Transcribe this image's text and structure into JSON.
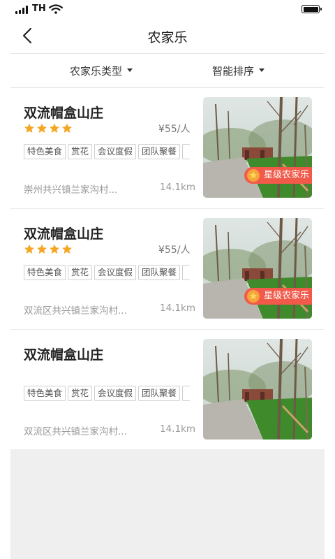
{
  "status": {
    "carrier": "TH"
  },
  "header": {
    "title": "农家乐"
  },
  "filters": [
    {
      "label": "农家乐类型"
    },
    {
      "label": "智能排序"
    }
  ],
  "listings": [
    {
      "name": "双流帽盒山庄",
      "rating": 4,
      "price": "¥55/人",
      "tags": [
        "特色美食",
        "赏花",
        "会议度假",
        "团队聚餐"
      ],
      "address": "崇州共兴镇兰家沟村...",
      "distance": "14.1km",
      "badge": "星级农家乐"
    },
    {
      "name": "双流帽盒山庄",
      "rating": 4,
      "price": "¥55/人",
      "tags": [
        "特色美食",
        "赏花",
        "会议度假",
        "团队聚餐"
      ],
      "address": "双流区共兴镇兰家沟村...",
      "distance": "14.1km",
      "badge": "星级农家乐"
    },
    {
      "name": "双流帽盒山庄",
      "rating": 0,
      "price": "",
      "tags": [
        "特色美食",
        "赏花",
        "会议度假",
        "团队聚餐"
      ],
      "address": "双流区共兴镇兰家沟村...",
      "distance": "14.1km",
      "badge": ""
    }
  ],
  "colors": {
    "star": "#f5a623",
    "badge": "#f15a4a",
    "grass": "#3f8a2a"
  },
  "icons": {
    "back": "chevron-left-icon",
    "star": "star-icon",
    "caret": "caret-down-icon"
  }
}
